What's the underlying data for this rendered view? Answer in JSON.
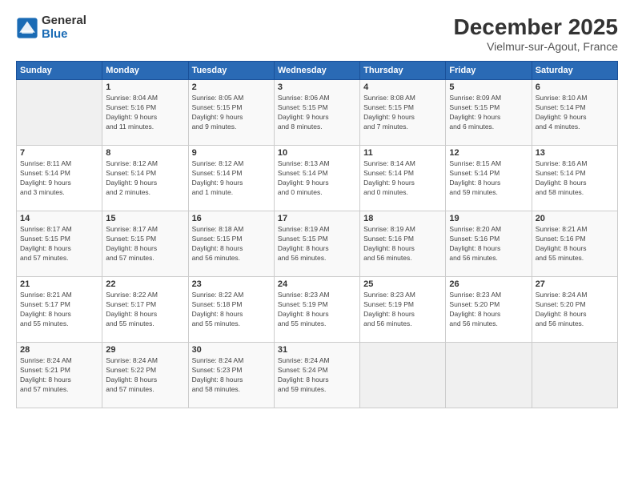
{
  "logo": {
    "general": "General",
    "blue": "Blue"
  },
  "title": "December 2025",
  "subtitle": "Vielmur-sur-Agout, France",
  "days": [
    "Sunday",
    "Monday",
    "Tuesday",
    "Wednesday",
    "Thursday",
    "Friday",
    "Saturday"
  ],
  "weeks": [
    [
      {
        "day": "",
        "info": ""
      },
      {
        "day": "1",
        "info": "Sunrise: 8:04 AM\nSunset: 5:16 PM\nDaylight: 9 hours\nand 11 minutes."
      },
      {
        "day": "2",
        "info": "Sunrise: 8:05 AM\nSunset: 5:15 PM\nDaylight: 9 hours\nand 9 minutes."
      },
      {
        "day": "3",
        "info": "Sunrise: 8:06 AM\nSunset: 5:15 PM\nDaylight: 9 hours\nand 8 minutes."
      },
      {
        "day": "4",
        "info": "Sunrise: 8:08 AM\nSunset: 5:15 PM\nDaylight: 9 hours\nand 7 minutes."
      },
      {
        "day": "5",
        "info": "Sunrise: 8:09 AM\nSunset: 5:15 PM\nDaylight: 9 hours\nand 6 minutes."
      },
      {
        "day": "6",
        "info": "Sunrise: 8:10 AM\nSunset: 5:14 PM\nDaylight: 9 hours\nand 4 minutes."
      }
    ],
    [
      {
        "day": "7",
        "info": "Sunrise: 8:11 AM\nSunset: 5:14 PM\nDaylight: 9 hours\nand 3 minutes."
      },
      {
        "day": "8",
        "info": "Sunrise: 8:12 AM\nSunset: 5:14 PM\nDaylight: 9 hours\nand 2 minutes."
      },
      {
        "day": "9",
        "info": "Sunrise: 8:12 AM\nSunset: 5:14 PM\nDaylight: 9 hours\nand 1 minute."
      },
      {
        "day": "10",
        "info": "Sunrise: 8:13 AM\nSunset: 5:14 PM\nDaylight: 9 hours\nand 0 minutes."
      },
      {
        "day": "11",
        "info": "Sunrise: 8:14 AM\nSunset: 5:14 PM\nDaylight: 9 hours\nand 0 minutes."
      },
      {
        "day": "12",
        "info": "Sunrise: 8:15 AM\nSunset: 5:14 PM\nDaylight: 8 hours\nand 59 minutes."
      },
      {
        "day": "13",
        "info": "Sunrise: 8:16 AM\nSunset: 5:14 PM\nDaylight: 8 hours\nand 58 minutes."
      }
    ],
    [
      {
        "day": "14",
        "info": "Sunrise: 8:17 AM\nSunset: 5:15 PM\nDaylight: 8 hours\nand 57 minutes."
      },
      {
        "day": "15",
        "info": "Sunrise: 8:17 AM\nSunset: 5:15 PM\nDaylight: 8 hours\nand 57 minutes."
      },
      {
        "day": "16",
        "info": "Sunrise: 8:18 AM\nSunset: 5:15 PM\nDaylight: 8 hours\nand 56 minutes."
      },
      {
        "day": "17",
        "info": "Sunrise: 8:19 AM\nSunset: 5:15 PM\nDaylight: 8 hours\nand 56 minutes."
      },
      {
        "day": "18",
        "info": "Sunrise: 8:19 AM\nSunset: 5:16 PM\nDaylight: 8 hours\nand 56 minutes."
      },
      {
        "day": "19",
        "info": "Sunrise: 8:20 AM\nSunset: 5:16 PM\nDaylight: 8 hours\nand 56 minutes."
      },
      {
        "day": "20",
        "info": "Sunrise: 8:21 AM\nSunset: 5:16 PM\nDaylight: 8 hours\nand 55 minutes."
      }
    ],
    [
      {
        "day": "21",
        "info": "Sunrise: 8:21 AM\nSunset: 5:17 PM\nDaylight: 8 hours\nand 55 minutes."
      },
      {
        "day": "22",
        "info": "Sunrise: 8:22 AM\nSunset: 5:17 PM\nDaylight: 8 hours\nand 55 minutes."
      },
      {
        "day": "23",
        "info": "Sunrise: 8:22 AM\nSunset: 5:18 PM\nDaylight: 8 hours\nand 55 minutes."
      },
      {
        "day": "24",
        "info": "Sunrise: 8:23 AM\nSunset: 5:19 PM\nDaylight: 8 hours\nand 55 minutes."
      },
      {
        "day": "25",
        "info": "Sunrise: 8:23 AM\nSunset: 5:19 PM\nDaylight: 8 hours\nand 56 minutes."
      },
      {
        "day": "26",
        "info": "Sunrise: 8:23 AM\nSunset: 5:20 PM\nDaylight: 8 hours\nand 56 minutes."
      },
      {
        "day": "27",
        "info": "Sunrise: 8:24 AM\nSunset: 5:20 PM\nDaylight: 8 hours\nand 56 minutes."
      }
    ],
    [
      {
        "day": "28",
        "info": "Sunrise: 8:24 AM\nSunset: 5:21 PM\nDaylight: 8 hours\nand 57 minutes."
      },
      {
        "day": "29",
        "info": "Sunrise: 8:24 AM\nSunset: 5:22 PM\nDaylight: 8 hours\nand 57 minutes."
      },
      {
        "day": "30",
        "info": "Sunrise: 8:24 AM\nSunset: 5:23 PM\nDaylight: 8 hours\nand 58 minutes."
      },
      {
        "day": "31",
        "info": "Sunrise: 8:24 AM\nSunset: 5:24 PM\nDaylight: 8 hours\nand 59 minutes."
      },
      {
        "day": "",
        "info": ""
      },
      {
        "day": "",
        "info": ""
      },
      {
        "day": "",
        "info": ""
      }
    ]
  ]
}
